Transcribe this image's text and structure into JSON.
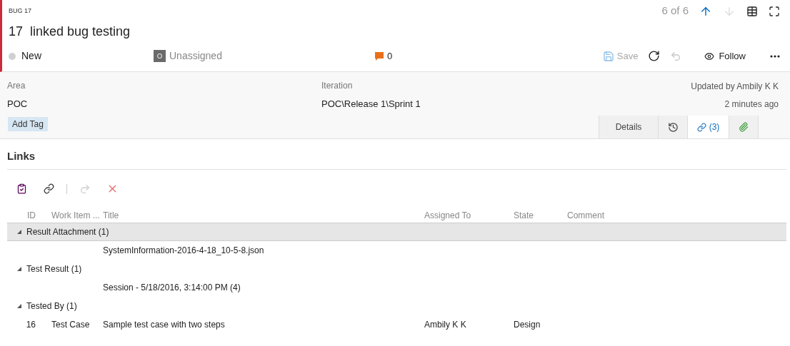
{
  "header": {
    "type_label": "BUG 17",
    "id": "17",
    "title": "linked bug testing",
    "position": "6 of 6",
    "nav": [
      {
        "kind": "up",
        "disabled": false
      },
      {
        "kind": "down",
        "disabled": true
      },
      {
        "kind": "grid"
      },
      {
        "kind": "fullscreen"
      }
    ],
    "state": "New",
    "assigned": "Unassigned",
    "comments": "0",
    "actions": [
      {
        "kind": "save",
        "label": "Save",
        "disabled": true
      },
      {
        "kind": "refresh",
        "disabled": false
      },
      {
        "kind": "undo",
        "disabled": true
      },
      {
        "kind": "follow",
        "label": "Follow",
        "disabled": false
      },
      {
        "kind": "more",
        "disabled": false
      }
    ]
  },
  "fields": [
    {
      "label": "Area",
      "value": "POC"
    },
    {
      "label": "Iteration",
      "value": "POC\\Release 1\\Sprint 1"
    }
  ],
  "updated": {
    "by": "Updated by Ambily K K",
    "when": "2 minutes ago"
  },
  "add_tag": "Add Tag",
  "tabs": [
    {
      "kind": "details",
      "label": "Details",
      "selected": false
    },
    {
      "kind": "history",
      "selected": false
    },
    {
      "kind": "links",
      "label": "(3)",
      "selected": true
    },
    {
      "kind": "attachments",
      "selected": false
    }
  ],
  "links": {
    "title": "Links",
    "toolbar": [
      {
        "kind": "new"
      },
      {
        "kind": "link"
      },
      {
        "kind": "separator"
      },
      {
        "kind": "open",
        "disabled": true
      },
      {
        "kind": "delete",
        "disabled": false
      }
    ],
    "columns": [
      "ID",
      "Work Item ...",
      "Title",
      "Assigned To",
      "State",
      "Comment"
    ],
    "groups": [
      {
        "label": "Result Attachment (1)",
        "selected": true,
        "expanded": true,
        "rows": [
          [
            "",
            "",
            "SystemInformation-2016-4-18_10-5-8.json",
            "",
            "",
            ""
          ]
        ]
      },
      {
        "label": "Test Result (1)",
        "selected": false,
        "expanded": true,
        "rows": [
          [
            "",
            "",
            "Session - 5/18/2016, 3:14:00 PM (4)",
            "",
            "",
            ""
          ]
        ]
      },
      {
        "label": "Tested By (1)",
        "selected": false,
        "expanded": true,
        "rows": [
          [
            "16",
            "Test Case",
            "Sample test case with two steps",
            "Ambily K K",
            "Design",
            ""
          ]
        ]
      }
    ]
  }
}
